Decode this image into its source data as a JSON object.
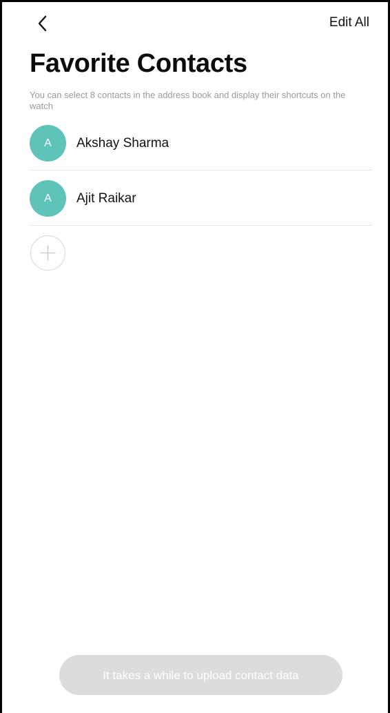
{
  "header": {
    "back_icon": "chevron-left-icon",
    "edit_all_label": "Edit All"
  },
  "page": {
    "title": "Favorite Contacts",
    "subtitle": "You can select 8 contacts in the address book and display their shortcuts on the watch"
  },
  "contacts": [
    {
      "initial": "A",
      "name": "Akshay Sharma"
    },
    {
      "initial": "A",
      "name": "Ajit Raikar"
    }
  ],
  "add_contact": {
    "icon": "plus-icon"
  },
  "footer": {
    "upload_label": "It takes a while to upload contact data"
  },
  "colors": {
    "avatar": "#5ec4b9",
    "subtitle_text": "#9a9a9a",
    "disabled_button": "#dcdcdc",
    "divider": "#e4e4e4"
  }
}
